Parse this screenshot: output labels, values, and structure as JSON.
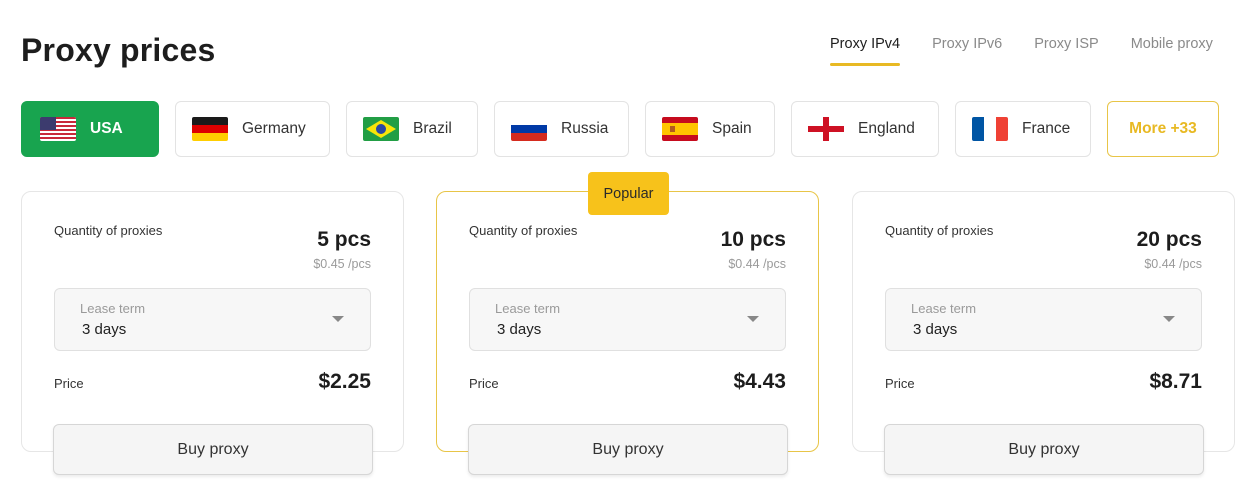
{
  "page_title": "Proxy prices",
  "proxy_types": [
    {
      "label": "Proxy IPv4",
      "active": true
    },
    {
      "label": "Proxy IPv6",
      "active": false
    },
    {
      "label": "Proxy ISP",
      "active": false
    },
    {
      "label": "Mobile proxy",
      "active": false
    }
  ],
  "countries": [
    {
      "label": "USA",
      "flag": "usa-flag-icon",
      "active": true
    },
    {
      "label": "Germany",
      "flag": "germany-flag-icon"
    },
    {
      "label": "Brazil",
      "flag": "brazil-flag-icon"
    },
    {
      "label": "Russia",
      "flag": "russia-flag-icon"
    },
    {
      "label": "Spain",
      "flag": "spain-flag-icon"
    },
    {
      "label": "England",
      "flag": "england-flag-icon"
    },
    {
      "label": "France",
      "flag": "france-flag-icon"
    }
  ],
  "more_countries": "More +33",
  "colors": {
    "accent_green": "#18a44f",
    "accent_yellow": "#f7c21b"
  },
  "cards": [
    {
      "qty_label": "Quantity of proxies",
      "qty": "5 pcs",
      "per_price": "$0.45 /pcs",
      "lease_label": "Lease term",
      "lease_value": "3 days",
      "price_label": "Price",
      "price": "$2.25",
      "buy_label": "Buy proxy"
    },
    {
      "badge": "Popular",
      "qty_label": "Quantity of proxies",
      "qty": "10 pcs",
      "per_price": "$0.44 /pcs",
      "lease_label": "Lease term",
      "lease_value": "3 days",
      "price_label": "Price",
      "price": "$4.43",
      "buy_label": "Buy proxy"
    },
    {
      "qty_label": "Quantity of proxies",
      "qty": "20 pcs",
      "per_price": "$0.44 /pcs",
      "lease_label": "Lease term",
      "lease_value": "3 days",
      "price_label": "Price",
      "price": "$8.71",
      "buy_label": "Buy proxy"
    }
  ]
}
